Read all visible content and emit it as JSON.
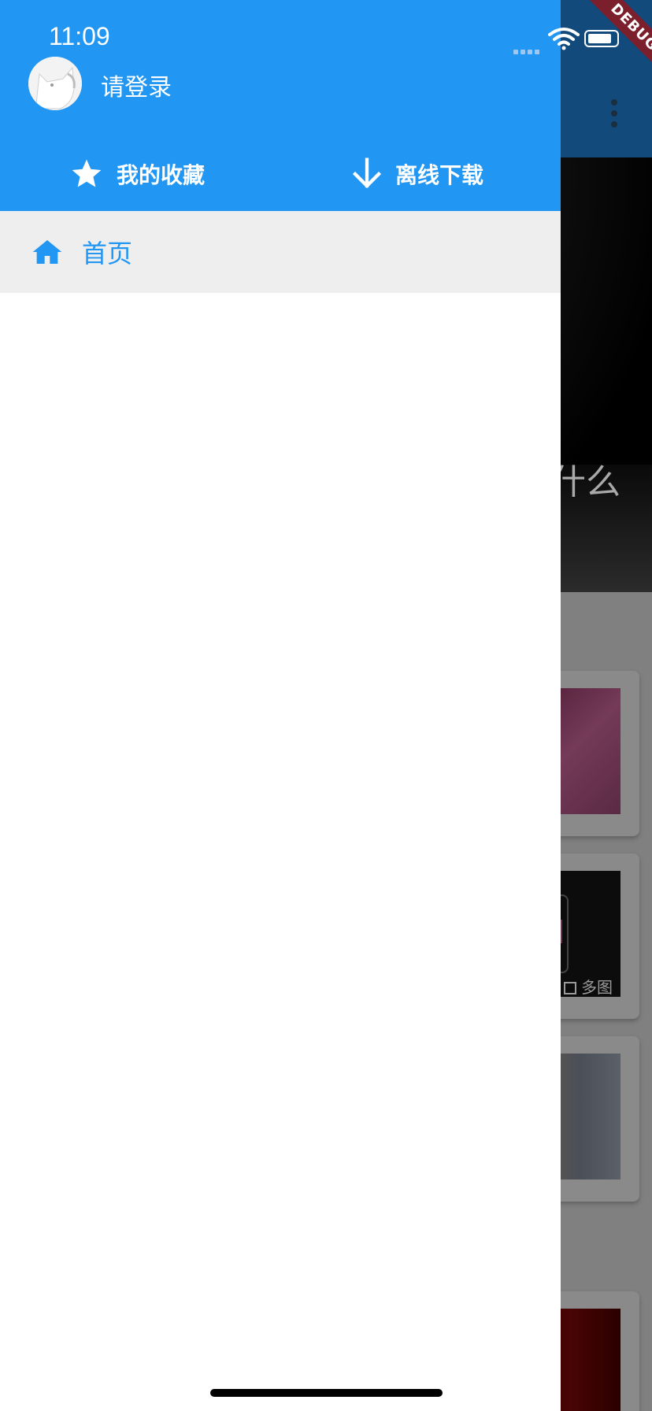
{
  "status_bar": {
    "time": "11:09"
  },
  "debug_banner": "DEBUG",
  "drawer": {
    "login_prompt": "请登录",
    "actions": [
      {
        "label": "我的收藏",
        "icon": "star-icon"
      },
      {
        "label": "离线下载",
        "icon": "arrow-down-icon"
      }
    ],
    "nav_items": [
      {
        "label": "首页",
        "icon": "home-icon",
        "selected": true
      }
    ]
  },
  "background": {
    "banner_text": "什么",
    "multi_image_badge": "多图"
  },
  "colors": {
    "primary": "#2196f3",
    "selected_row_bg": "#eeeeee",
    "drawer_bg": "#ffffff",
    "scrim": "#7f7f7f"
  }
}
